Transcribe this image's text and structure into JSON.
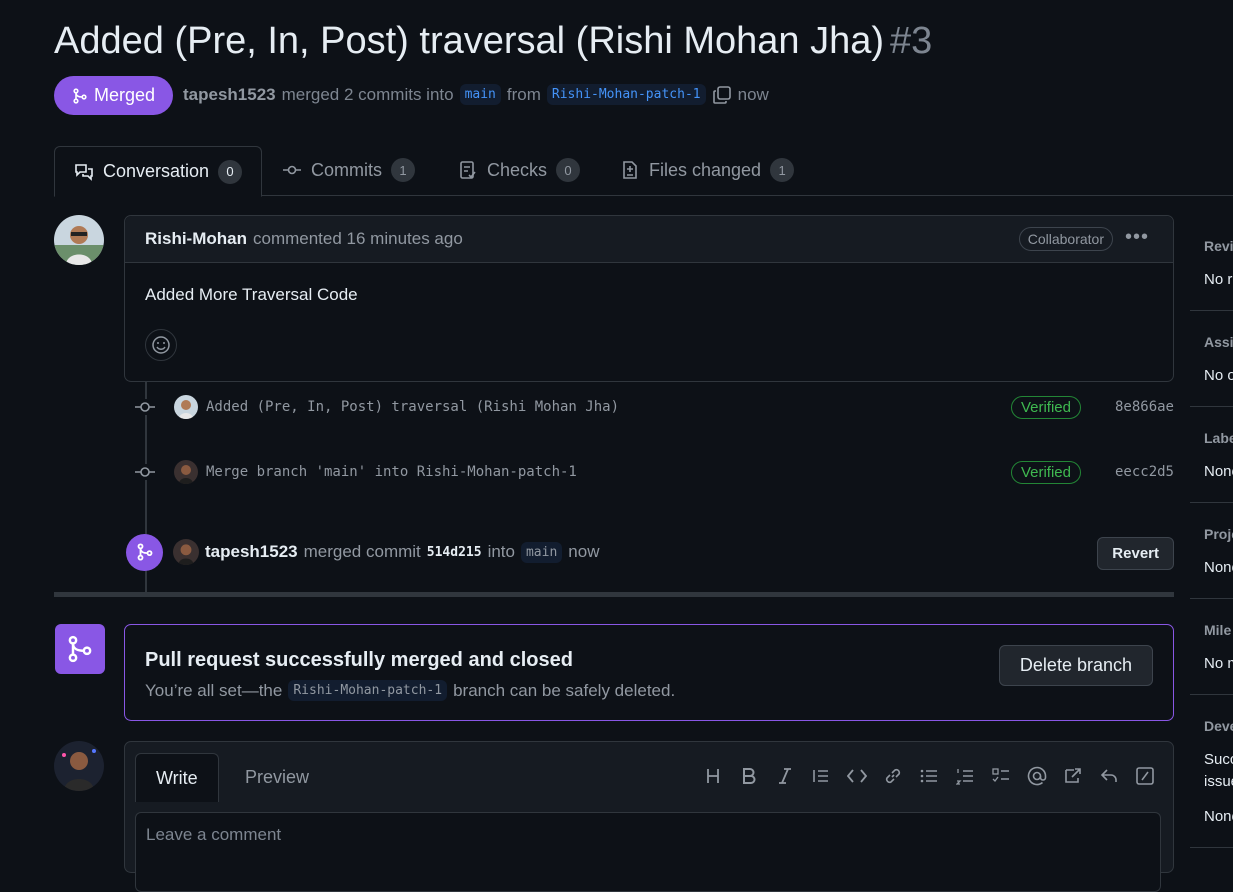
{
  "pr": {
    "title": "Added (Pre, In, Post) traversal (Rishi Mohan Jha)",
    "number": "#3",
    "state": "Merged",
    "merger": "tapesh1523",
    "merged_text": "merged 2 commits into",
    "base_branch": "main",
    "from_text": "from",
    "head_branch": "Rishi-Mohan-patch-1",
    "time": "now"
  },
  "tabs": [
    {
      "label": "Conversation",
      "count": "0"
    },
    {
      "label": "Commits",
      "count": "1"
    },
    {
      "label": "Checks",
      "count": "0"
    },
    {
      "label": "Files changed",
      "count": "1"
    }
  ],
  "comment": {
    "author": "Rishi-Mohan",
    "action": "commented 16 minutes ago",
    "role": "Collaborator",
    "body": "Added More Traversal Code"
  },
  "commits": [
    {
      "message": "Added (Pre, In, Post) traversal (Rishi Mohan Jha)",
      "verified": "Verified",
      "sha": "8e866ae"
    },
    {
      "message": "Merge branch 'main' into Rishi-Mohan-patch-1",
      "verified": "Verified",
      "sha": "eecc2d5"
    }
  ],
  "merge_event": {
    "author": "tapesh1523",
    "text": "merged commit",
    "sha": "514d215",
    "into": "into",
    "branch": "main",
    "time": "now",
    "revert_label": "Revert"
  },
  "merged_panel": {
    "heading": "Pull request successfully merged and closed",
    "sub_pre": "You’re all set—the",
    "branch": "Rishi-Mohan-patch-1",
    "sub_post": "branch can be safely deleted.",
    "delete_label": "Delete branch"
  },
  "editor": {
    "write_tab": "Write",
    "preview_tab": "Preview",
    "placeholder": "Leave a comment"
  },
  "sidebar": [
    {
      "label": "Revi",
      "value": "No r"
    },
    {
      "label": "Assig",
      "value": "No o"
    },
    {
      "label": "Labe",
      "value": "None"
    },
    {
      "label": "Proje",
      "value": "None"
    },
    {
      "label": "Mile",
      "value": "No m"
    },
    {
      "label": "Deve",
      "value": "Succ",
      "value2": "issue",
      "value3": "None"
    }
  ],
  "colors": {
    "merged_purple": "#8957e5",
    "verified_green": "#3fb950",
    "link_blue": "#4493f8",
    "bg": "#0d1117"
  }
}
